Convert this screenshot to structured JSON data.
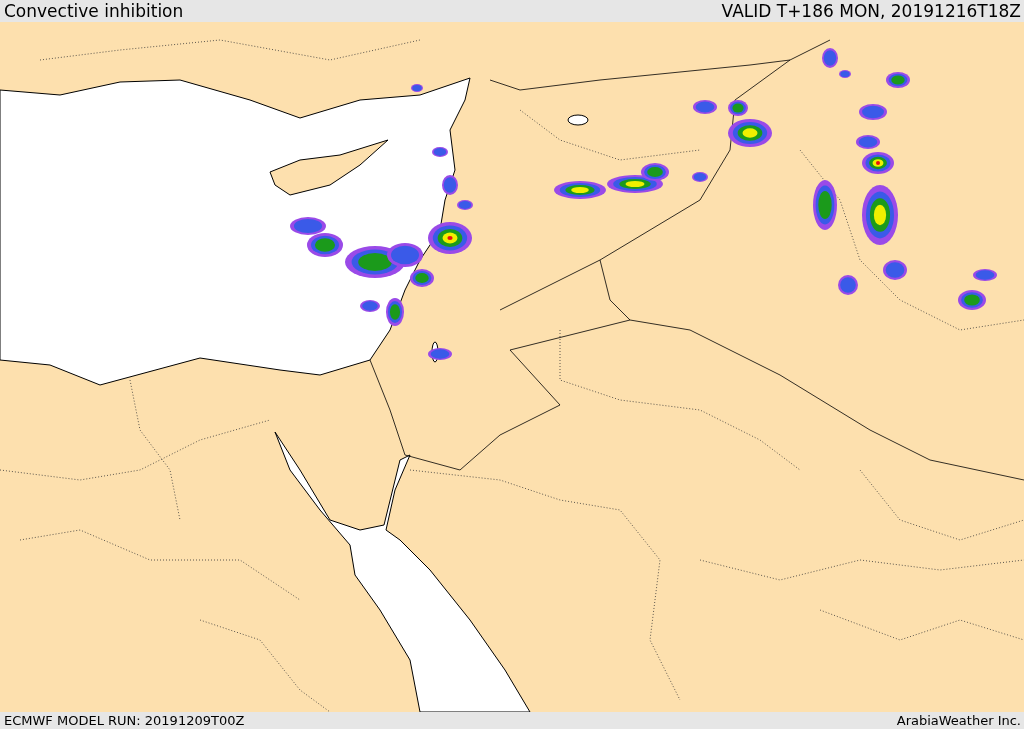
{
  "header": {
    "title": "Convective inhibition",
    "valid_time": "VALID T+186 MON, 20191216T18Z"
  },
  "footer": {
    "model_run": "ECMWF MODEL RUN: 20191209T00Z",
    "credit": "ArabiaWeather Inc."
  }
}
